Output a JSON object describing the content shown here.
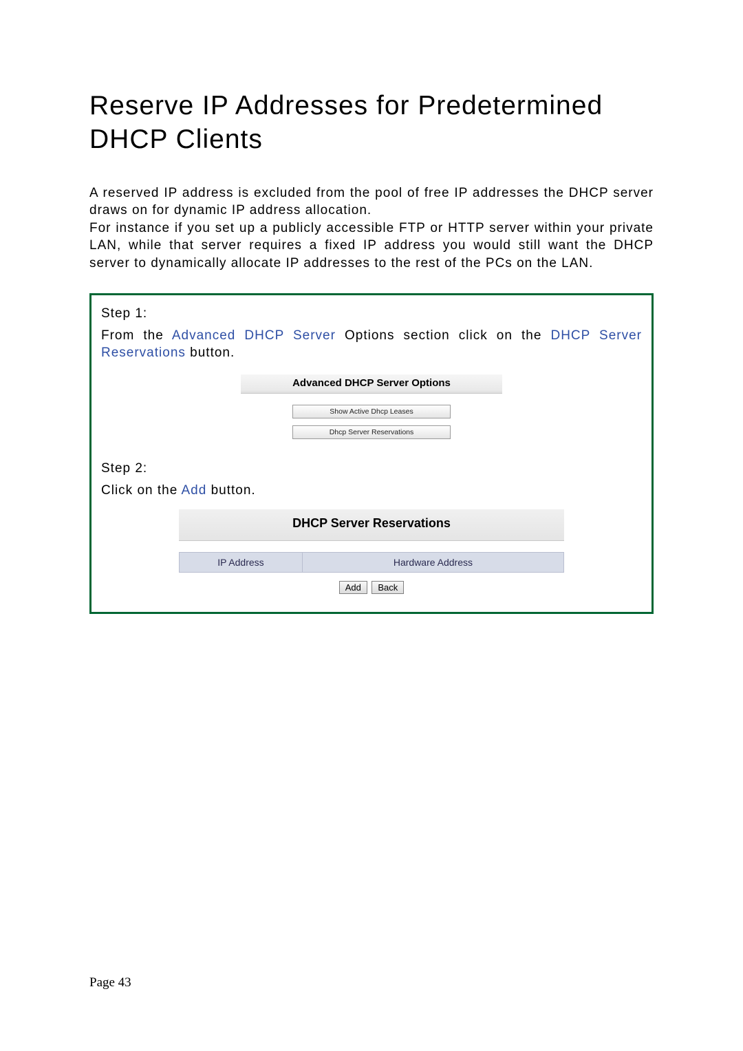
{
  "title": "Reserve IP Addresses for Predetermined DHCP Clients",
  "intro": "A reserved IP address is excluded from the pool of free IP addresses the DHCP server draws on for dynamic IP address allocation.\nFor instance if you set up a publicly accessible FTP or HTTP server within your private LAN, while that server requires a fixed IP address you would still want the DHCP server to dynamically allocate IP addresses to the rest of the PCs on the LAN.",
  "step1": {
    "label": "Step 1:",
    "prefix": "From the ",
    "link1": "Advanced DHCP Server",
    "mid": " Options section click on the ",
    "link2": "DHCP Server Reservations",
    "suffix": " button."
  },
  "fig1": {
    "heading": "Advanced DHCP Server Options",
    "btn_leases": "Show Active Dhcp Leases",
    "btn_reservations": "Dhcp Server Reservations"
  },
  "step2": {
    "label": "Step 2:",
    "prefix": "Click on the ",
    "link": "Add",
    "suffix": " button."
  },
  "fig2": {
    "heading": "DHCP Server Reservations",
    "col_ip": "IP Address",
    "col_hw": "Hardware Address",
    "btn_add": "Add",
    "btn_back": "Back"
  },
  "page_number": "Page 43"
}
